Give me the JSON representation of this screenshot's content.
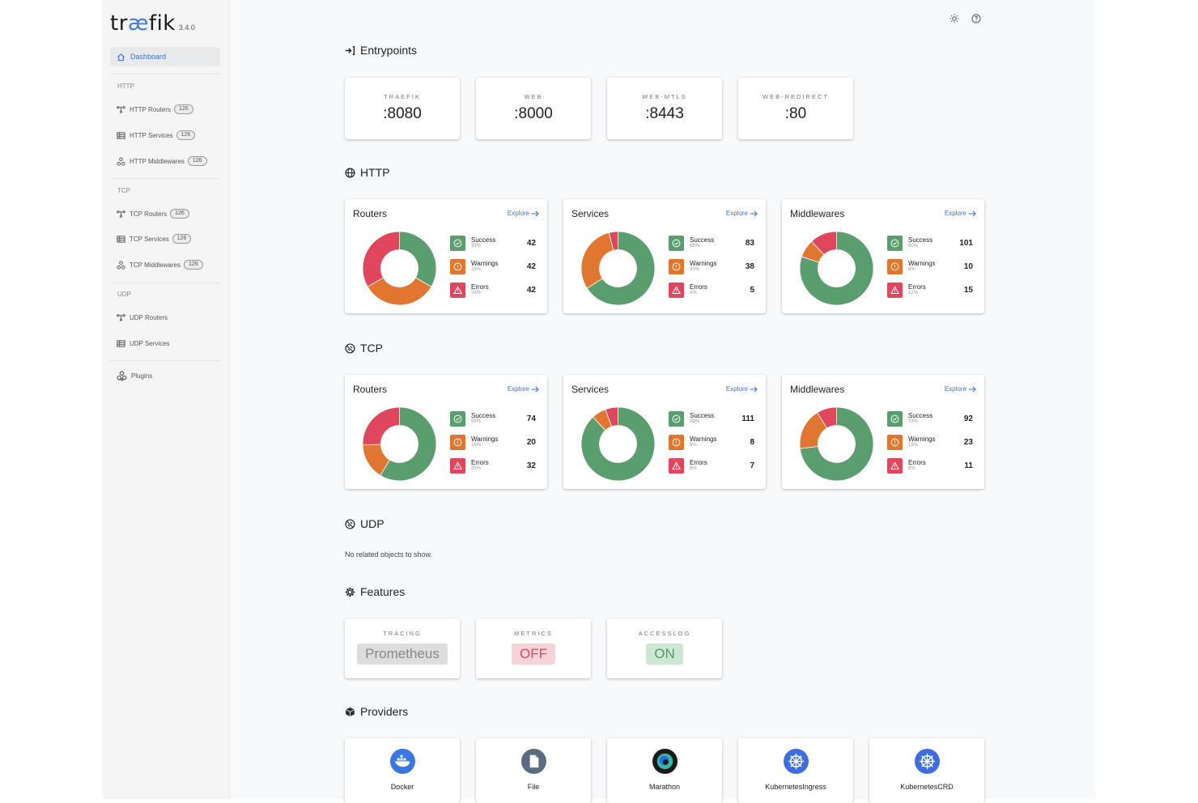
{
  "app": {
    "logo_pre": "tr",
    "logo_ae": "æ",
    "logo_post": "fik",
    "version": "3.4.0"
  },
  "sidebar": {
    "dashboard": "Dashboard",
    "http_heading": "HTTP",
    "tcp_heading": "TCP",
    "udp_heading": "UDP",
    "http_routers": "HTTP Routers",
    "http_routers_count": "126",
    "http_services": "HTTP Services",
    "http_services_count": "126",
    "http_middlewares": "HTTP Middlewares",
    "http_middlewares_count": "126",
    "tcp_routers": "TCP Routers",
    "tcp_routers_count": "126",
    "tcp_services": "TCP Services",
    "tcp_services_count": "126",
    "tcp_middlewares": "TCP Middlewares",
    "tcp_middlewares_count": "126",
    "udp_routers": "UDP Routers",
    "udp_services": "UDP Services",
    "plugins": "Plugins"
  },
  "entrypoints": {
    "title": "Entrypoints",
    "items": [
      {
        "name": "TRAEFIK",
        "port": ":8080"
      },
      {
        "name": "WEB",
        "port": ":8000"
      },
      {
        "name": "WEB-MTLS",
        "port": ":8443"
      },
      {
        "name": "WEB-REDIRECT",
        "port": ":80"
      }
    ]
  },
  "legend_labels": {
    "success": "Success",
    "warnings": "Warnings",
    "errors": "Errors",
    "explore": "Explore"
  },
  "colors": {
    "success": "#5a9e6f",
    "warnings": "#e07630",
    "errors": "#e0475e",
    "accent": "#3f6fd0"
  },
  "http": {
    "title": "HTTP",
    "routers": {
      "title": "Routers",
      "success": 42,
      "success_pct": "33%",
      "warnings": 42,
      "warnings_pct": "33%",
      "errors": 42,
      "errors_pct": "33%"
    },
    "services": {
      "title": "Services",
      "success": 83,
      "success_pct": "66%",
      "warnings": 38,
      "warnings_pct": "30%",
      "errors": 5,
      "errors_pct": "4%"
    },
    "middlewares": {
      "title": "Middlewares",
      "success": 101,
      "success_pct": "80%",
      "warnings": 10,
      "warnings_pct": "8%",
      "errors": 15,
      "errors_pct": "12%"
    }
  },
  "tcp": {
    "title": "TCP",
    "routers": {
      "title": "Routers",
      "success": 74,
      "success_pct": "59%",
      "warnings": 20,
      "warnings_pct": "16%",
      "errors": 32,
      "errors_pct": "25%"
    },
    "services": {
      "title": "Services",
      "success": 111,
      "success_pct": "88%",
      "warnings": 8,
      "warnings_pct": "6%",
      "errors": 7,
      "errors_pct": "6%"
    },
    "middlewares": {
      "title": "Middlewares",
      "success": 92,
      "success_pct": "73%",
      "warnings": 23,
      "warnings_pct": "18%",
      "errors": 11,
      "errors_pct": "9%"
    }
  },
  "udp": {
    "title": "UDP",
    "empty": "No related objects to show."
  },
  "features": {
    "title": "Features",
    "items": [
      {
        "name": "TRACING",
        "value": "Prometheus"
      },
      {
        "name": "METRICS",
        "value": "OFF"
      },
      {
        "name": "ACCESSLOG",
        "value": "ON"
      }
    ]
  },
  "providers": {
    "title": "Providers",
    "items": [
      {
        "name": "Docker",
        "icon": "docker-icon"
      },
      {
        "name": "File",
        "icon": "file-icon"
      },
      {
        "name": "Marathon",
        "icon": "marathon-icon"
      },
      {
        "name": "KubernetesIngress",
        "icon": "kubernetes-icon"
      },
      {
        "name": "KubernetesCRD",
        "icon": "kubernetes-icon"
      }
    ]
  }
}
